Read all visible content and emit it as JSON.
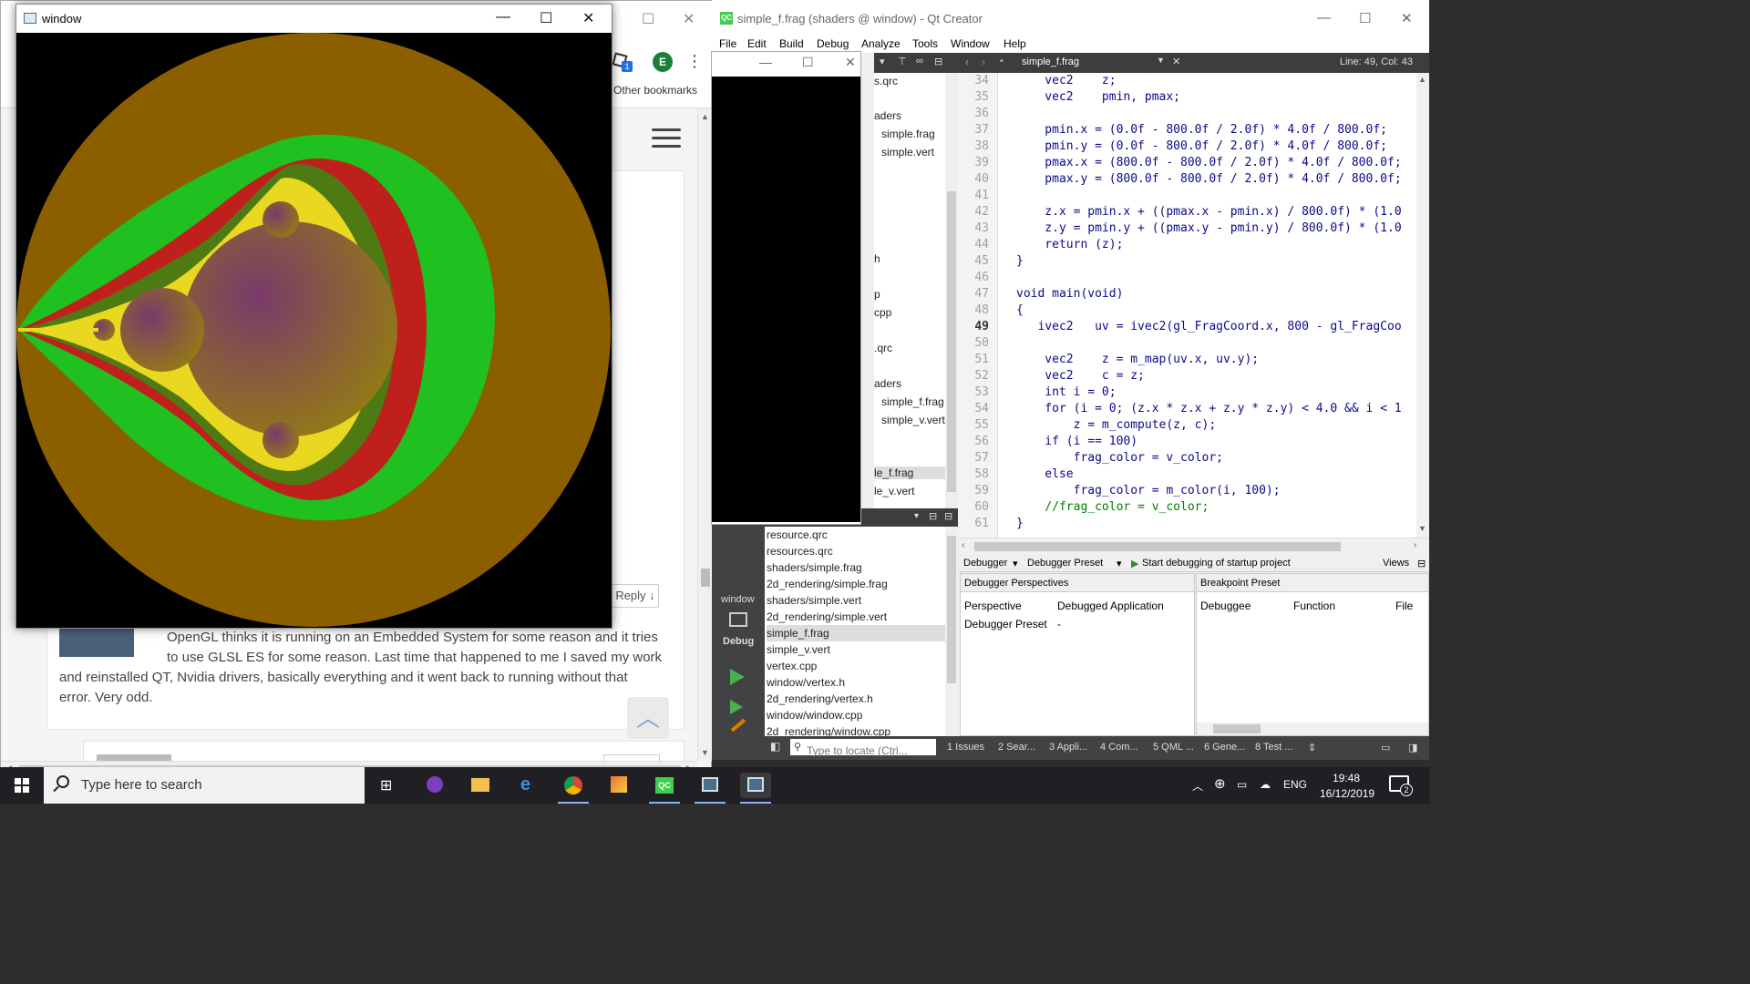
{
  "browser": {
    "other_bookmarks": "Other bookmarks",
    "extension_badge": "1",
    "profile_letter": "E",
    "reply_button": "Reply ↓",
    "comment_line1": "OpenGL thinks it is running on an Embedded System for some reason and it tries",
    "comment_line2": "to use GLSL ES for some reason. Last time that happened to me I saved my work",
    "comment_line3": "and reinstalled QT, Nvidia drivers, basically everything and it went back to running without that",
    "comment_line4": "error. Very odd.",
    "next_author_partial": "M... ... C..."
  },
  "gl_window": {
    "title": "window",
    "colors": {
      "background": "#000000",
      "outer_band": "#8b5e00",
      "green_band": "#20c020",
      "red_band": "#c0201c",
      "olive_band": "#4e7a14",
      "yellow_band": "#e8d820",
      "interior_center": "#7a3a6a",
      "interior_edge": "#9a8a00"
    }
  },
  "qt": {
    "title": "simple_f.frag (shaders @ window) - Qt Creator",
    "logo": "QC",
    "menu": [
      "File",
      "Edit",
      "Build",
      "Debug",
      "Analyze",
      "Tools",
      "Window",
      "Help"
    ],
    "editor_tab": "simple_f.frag",
    "cursor_pos": "Line: 49, Col: 43",
    "project_tree": [
      {
        "label": "s.qrc",
        "indent": false
      },
      {
        "label": "aders",
        "indent": false
      },
      {
        "label": "simple.frag",
        "indent": true
      },
      {
        "label": "simple.vert",
        "indent": true
      },
      {
        "label": "h",
        "indent": false
      },
      {
        "label": "p",
        "indent": false
      },
      {
        "label": "cpp",
        "indent": false
      },
      {
        "label": ".qrc",
        "indent": false
      },
      {
        "label": "aders",
        "indent": false
      },
      {
        "label": "simple_f.frag",
        "indent": true
      },
      {
        "label": "simple_v.vert",
        "indent": true
      },
      {
        "label": "le_f.frag",
        "indent": false
      },
      {
        "label": "le_v.vert",
        "indent": false
      }
    ],
    "code_lines": [
      {
        "n": "34",
        "t": "    vec2    z;"
      },
      {
        "n": "35",
        "t": "    vec2    pmin, pmax;"
      },
      {
        "n": "36",
        "t": ""
      },
      {
        "n": "37",
        "t": "    pmin.x = (0.0f - 800.0f / 2.0f) * 4.0f / 800.0f;"
      },
      {
        "n": "38",
        "t": "    pmin.y = (0.0f - 800.0f / 2.0f) * 4.0f / 800.0f;"
      },
      {
        "n": "39",
        "t": "    pmax.x = (800.0f - 800.0f / 2.0f) * 4.0f / 800.0f;"
      },
      {
        "n": "40",
        "t": "    pmax.y = (800.0f - 800.0f / 2.0f) * 4.0f / 800.0f;"
      },
      {
        "n": "41",
        "t": ""
      },
      {
        "n": "42",
        "t": "    z.x = pmin.x + ((pmax.x - pmin.x) / 800.0f) * (1.0"
      },
      {
        "n": "43",
        "t": "    z.y = pmin.y + ((pmax.y - pmin.y) / 800.0f) * (1.0"
      },
      {
        "n": "44",
        "t": "    return (z);"
      },
      {
        "n": "45",
        "t": "}"
      },
      {
        "n": "46",
        "t": ""
      },
      {
        "n": "47",
        "t": "void main(void)"
      },
      {
        "n": "48",
        "t": "{"
      },
      {
        "n": "49",
        "t": "   ivec2   uv = ivec2(gl_FragCoord.x, 800 - gl_FragCoo"
      },
      {
        "n": "50",
        "t": ""
      },
      {
        "n": "51",
        "t": "    vec2    z = m_map(uv.x, uv.y);"
      },
      {
        "n": "52",
        "t": "    vec2    c = z;"
      },
      {
        "n": "53",
        "t": "    int i = 0;"
      },
      {
        "n": "54",
        "t": "    for (i = 0; (z.x * z.x + z.y * z.y) < 4.0 && i < 1"
      },
      {
        "n": "55",
        "t": "        z = m_compute(z, c);"
      },
      {
        "n": "56",
        "t": "    if (i == 100)"
      },
      {
        "n": "57",
        "t": "        frag_color = v_color;"
      },
      {
        "n": "58",
        "t": "    else"
      },
      {
        "n": "59",
        "t": "        frag_color = m_color(i, 100);"
      },
      {
        "n": "60",
        "t": "    //frag_color = v_color;"
      },
      {
        "n": "61",
        "t": "}"
      }
    ],
    "mode_label": "window",
    "mode_debug": "Debug",
    "open_files": [
      "resource.qrc",
      "resources.qrc",
      "shaders/simple.frag",
      "2d_rendering/simple.frag",
      "shaders/simple.vert",
      "2d_rendering/simple.vert",
      "simple_f.frag",
      "simple_v.vert",
      "vertex.cpp",
      "window/vertex.h",
      "2d_rendering/vertex.h",
      "window/window.cpp",
      "2d_rendering/window.cpp"
    ],
    "debugger": {
      "combo1": "Debugger",
      "combo2": "Debugger Preset",
      "start": "Start debugging of startup project",
      "views": "Views",
      "left_header": "Debugger Perspectives",
      "col1": "Perspective",
      "col2": "Debugged Application",
      "row1_col1": "Debugger Preset",
      "row1_col2": "-",
      "right_header": "Breakpoint Preset",
      "rcol1": "Debuggee",
      "rcol2": "Function",
      "rcol3": "File"
    },
    "status": {
      "locator_placeholder": "Type to locate (Ctrl...",
      "tabs": [
        "1  Issues",
        "2  Sear...",
        "3  Appli...",
        "4  Com...",
        "5  QML ...",
        "6  Gene...",
        "8  Test ..."
      ]
    }
  },
  "taskbar": {
    "search_placeholder": "Type here to search",
    "lang": "ENG",
    "time": "19:48",
    "date": "16/12/2019",
    "notifications": "2"
  }
}
